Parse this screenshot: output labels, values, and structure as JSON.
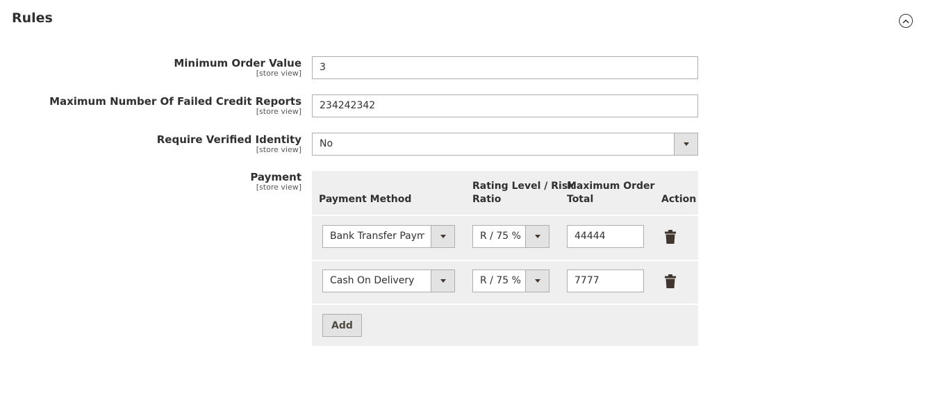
{
  "section": {
    "title": "Rules"
  },
  "fields": {
    "min_order": {
      "label": "Minimum Order Value",
      "scope": "[store view]",
      "value": "3"
    },
    "max_failed": {
      "label": "Maximum Number Of Failed Credit Reports",
      "scope": "[store view]",
      "value": "234242342"
    },
    "verified_identity": {
      "label": "Require Verified Identity",
      "scope": "[store view]",
      "value": "No"
    },
    "payment": {
      "label": "Payment",
      "scope": "[store view]"
    }
  },
  "payment_table": {
    "headers": {
      "method": "Payment Method",
      "rating_line1": "Rating Level / Risk",
      "rating_line2": "Ratio",
      "max_line1": "Maximum Order",
      "max_line2": "Total",
      "action": "Action"
    },
    "rows": [
      {
        "method": "Bank Transfer Payment",
        "rating": "R / 75 %",
        "max_total": "44444"
      },
      {
        "method": "Cash On Delivery",
        "rating": "R / 75 %",
        "max_total": "7777"
      }
    ],
    "add_label": "Add"
  },
  "icons": {
    "collapse": "chevron-up-circle-icon",
    "delete": "trash-icon",
    "dropdown": "caret-down-icon"
  }
}
